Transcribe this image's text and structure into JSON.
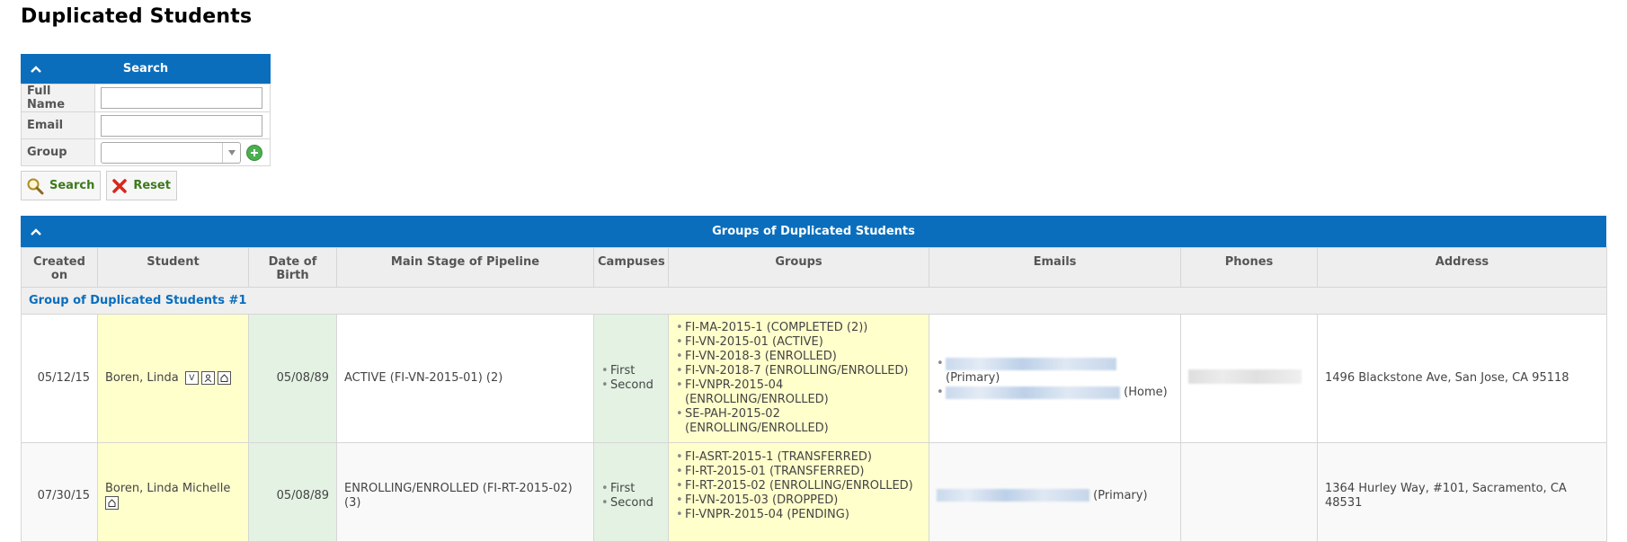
{
  "page": {
    "title": "Duplicated Students"
  },
  "search": {
    "header": "Search",
    "fields": {
      "full_name_label": "Full Name",
      "full_name_value": "",
      "email_label": "Email",
      "email_value": "",
      "group_label": "Group",
      "group_value": ""
    },
    "search_button": "Search",
    "reset_button": "Reset"
  },
  "groups": {
    "header": "Groups of Duplicated Students",
    "columns": [
      "Created on",
      "Student",
      "Date of Birth",
      "Main Stage of Pipeline",
      "Campuses",
      "Groups",
      "Emails",
      "Phones",
      "Address"
    ],
    "group_title": "Group of Duplicated Students #1",
    "rows": [
      {
        "created": "05/12/15",
        "student": "Boren, Linda",
        "dob": "05/08/89",
        "stage": "ACTIVE (FI-VN-2015-01) (2)",
        "campuses": [
          "First",
          "Second"
        ],
        "groups": [
          "FI-MA-2015-1 (COMPLETED (2))",
          "FI-VN-2015-01 (ACTIVE)",
          "FI-VN-2018-3 (ENROLLED)",
          "FI-VN-2018-7 (ENROLLING/ENROLLED)",
          "FI-VNPR-2015-04 (ENROLLING/ENROLLED)",
          "SE-PAH-2015-02 (ENROLLING/ENROLLED)"
        ],
        "email_types": [
          "(Primary)",
          "(Home)"
        ],
        "address": "1496 Blackstone Ave, San Jose, CA 95118"
      },
      {
        "created": "07/30/15",
        "student": "Boren, Linda Michelle",
        "dob": "05/08/89",
        "stage": "ENROLLING/ENROLLED (FI-RT-2015-02) (3)",
        "campuses": [
          "First",
          "Second"
        ],
        "groups": [
          "FI-ASRT-2015-1 (TRANSFERRED)",
          "FI-RT-2015-01 (TRANSFERRED)",
          "FI-RT-2015-02 (ENROLLING/ENROLLED)",
          "FI-VN-2015-03 (DROPPED)",
          "FI-VNPR-2015-04 (PENDING)"
        ],
        "email_types": [
          "(Primary)"
        ],
        "address": "1364 Hurley Way, #101, Sacramento, CA 48531"
      }
    ]
  },
  "colors": {
    "header_blue": "#0a6ebd",
    "yellow_cell": "#ffffcc",
    "green_cell": "#e3f2e3"
  }
}
